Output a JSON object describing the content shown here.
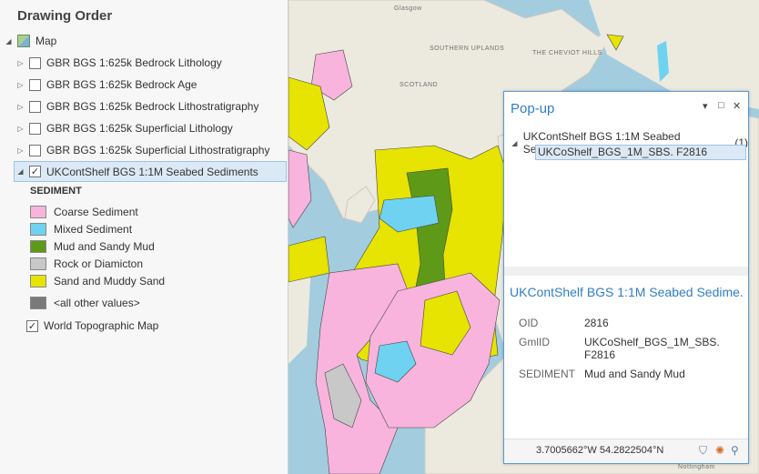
{
  "contents": {
    "title": "Drawing Order",
    "map_label": "Map",
    "layers": [
      {
        "label": "GBR BGS 1:625k Bedrock Lithology",
        "checked": false
      },
      {
        "label": "GBR BGS 1:625k Bedrock Age",
        "checked": false
      },
      {
        "label": "GBR BGS 1:625k Bedrock Lithostratigraphy",
        "checked": false
      },
      {
        "label": "GBR BGS 1:625k Superficial Lithology",
        "checked": false
      },
      {
        "label": "GBR BGS 1:625k Superficial Lithostratigraphy",
        "checked": false
      },
      {
        "label": "UKContShelf BGS 1:1M Seabed Sediments",
        "checked": true
      }
    ],
    "legend_heading": "SEDIMENT",
    "legend": [
      {
        "label": "Coarse Sediment",
        "color": "#f8b4dc"
      },
      {
        "label": "Mixed Sediment",
        "color": "#6fd2f0"
      },
      {
        "label": "Mud and Sandy Mud",
        "color": "#5e9a17"
      },
      {
        "label": "Rock or Diamicton",
        "color": "#c8c8c8"
      },
      {
        "label": "Sand and Muddy Sand",
        "color": "#e6e400"
      },
      {
        "label": "<all other values>",
        "color": "#7a7a7a"
      }
    ],
    "basemap_label": "World Topographic Map"
  },
  "map": {
    "labels": {
      "glasgow": "Glasgow",
      "southern_uplands": "SOUTHERN UPLANDS",
      "scotland": "SCOTLAND",
      "cheviot_hills": "THE CHEVIOT HILLS",
      "nottingham": "Nottingham"
    }
  },
  "popup": {
    "title": "Pop-up",
    "layer_entry": "UKContShelf BGS 1:1M Seabed Sediments",
    "layer_count": "(1)",
    "feature_entry": "UKCoShelf_BGS_1M_SBS. F2816",
    "detail_title": "UKContShelf BGS 1:1M Seabed Sedime...",
    "attributes": [
      {
        "name": "OID",
        "value": "2816"
      },
      {
        "name": "GmlID",
        "value": "UKCoShelf_BGS_1M_SBS. F2816"
      },
      {
        "name": "SEDIMENT",
        "value": "Mud and Sandy Mud"
      }
    ],
    "coordinates": "3.7005662°W 54.2822504°N"
  },
  "icons": {
    "expand_collapsed": "▷",
    "expand_open": "◢",
    "check": "✓"
  }
}
